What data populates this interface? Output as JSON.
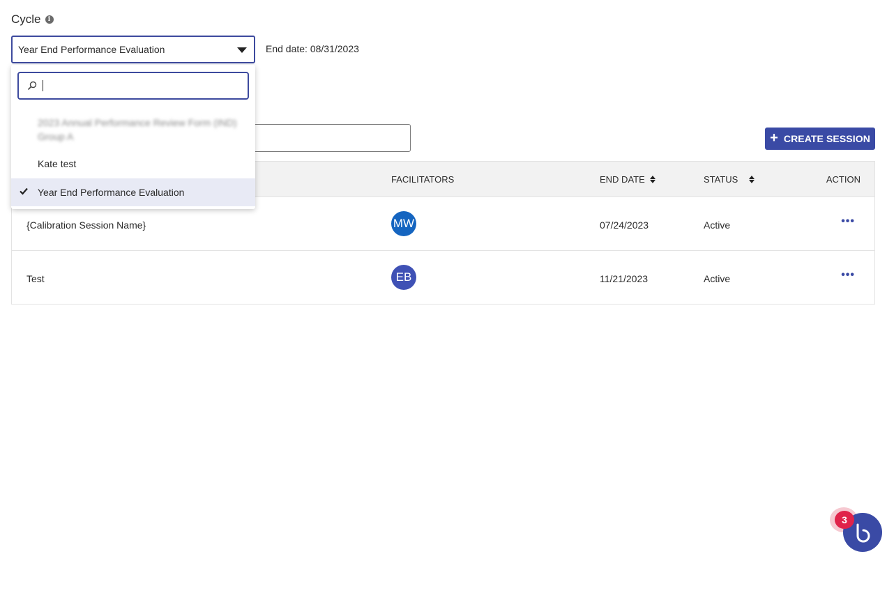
{
  "cycle": {
    "label": "Cycle",
    "selected_value": "Year End Performance Evaluation",
    "end_date_text": "End date: 08/31/2023"
  },
  "dropdown": {
    "search_placeholder": "",
    "options": [
      {
        "label": "2023 Annual Performance Review Form (IND) Group A",
        "blurred": true
      },
      {
        "label": "Kate test"
      },
      {
        "label": "Year End Performance Evaluation",
        "selected": true
      }
    ]
  },
  "toolbar": {
    "create_label": "CREATE SESSION"
  },
  "table": {
    "columns": {
      "facilitators": "FACILITATORS",
      "end_date": "END DATE",
      "status": "STATUS",
      "action": "ACTION"
    },
    "rows": [
      {
        "name": "{Calibration Session Name}",
        "facilitator_initials": "MW",
        "facilitator_color": "#1565c0",
        "end_date": "07/24/2023",
        "status": "Active"
      },
      {
        "name": "Test",
        "facilitator_initials": "EB",
        "facilitator_color": "#3f51b5",
        "end_date": "11/21/2023",
        "status": "Active"
      }
    ]
  },
  "chat": {
    "badge_count": "3"
  },
  "colors": {
    "accent": "#3a4aa5",
    "badge": "#e0234a"
  }
}
